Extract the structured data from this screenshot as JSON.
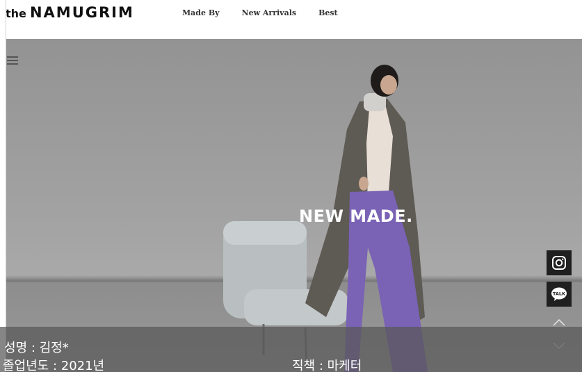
{
  "header": {
    "logo_prefix": "the",
    "logo_main": "NAMUGRIM",
    "nav": [
      {
        "label": "Made By"
      },
      {
        "label": "New Arrivals"
      },
      {
        "label": "Best"
      }
    ]
  },
  "hero": {
    "title": "NEW MADE."
  },
  "side": {
    "icons": [
      "instagram-icon",
      "kakao-talk-icon",
      "chevron-up-icon",
      "chevron-down-icon"
    ],
    "talk_label": "TALK"
  },
  "footer": {
    "name": "성명 : 김정*",
    "year": "졸업년도 : 2021년",
    "role": "직책 : 마케터"
  }
}
